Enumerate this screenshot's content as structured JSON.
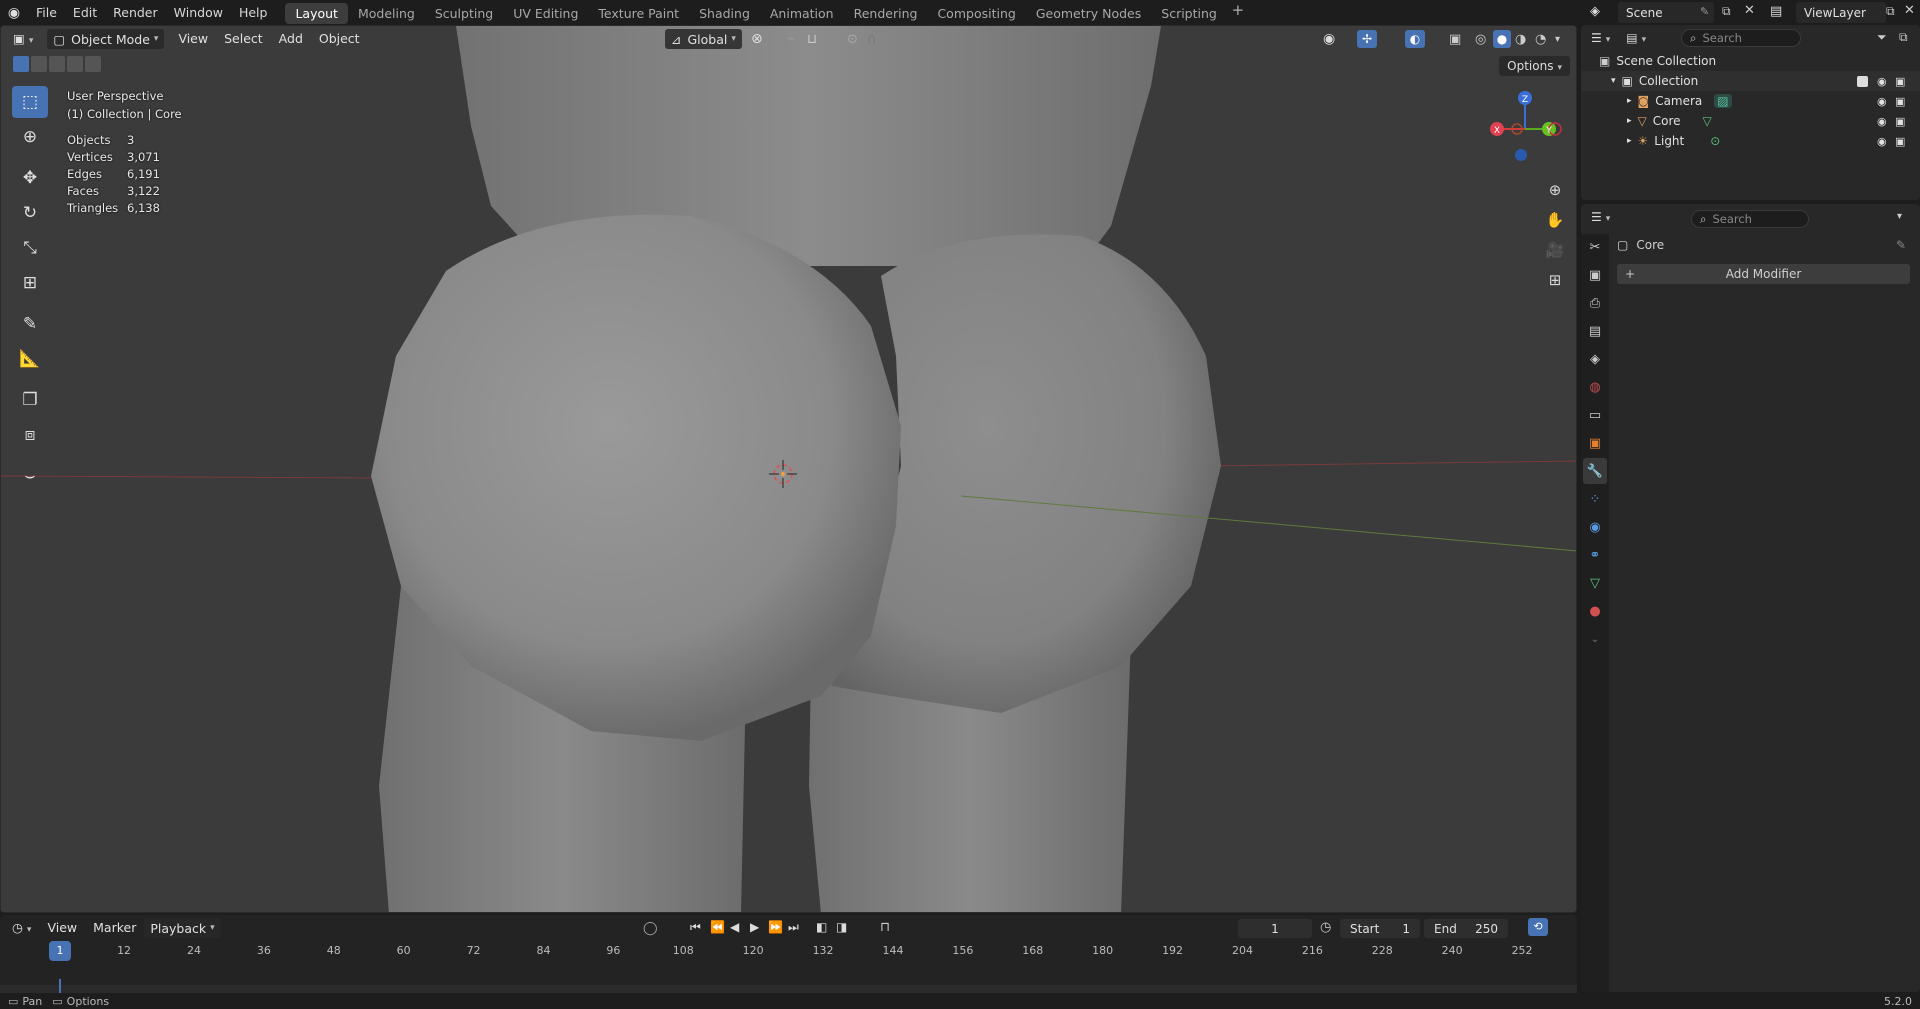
{
  "topbar": {
    "menus": [
      "File",
      "Edit",
      "Render",
      "Window",
      "Help"
    ],
    "workspaces": [
      "Layout",
      "Modeling",
      "Sculpting",
      "UV Editing",
      "Texture Paint",
      "Shading",
      "Animation",
      "Rendering",
      "Compositing",
      "Geometry Nodes",
      "Scripting"
    ],
    "active_workspace": "Layout",
    "scene": "Scene",
    "view_layer": "ViewLayer"
  },
  "viewport": {
    "mode": "Object Mode",
    "menus": [
      "View",
      "Select",
      "Add",
      "Object"
    ],
    "transform_orientation": "Global",
    "options_label": "Options",
    "overlay_title": "User Perspective",
    "overlay_subtitle": "(1) Collection | Core",
    "stats": [
      {
        "label": "Objects",
        "value": "3"
      },
      {
        "label": "Vertices",
        "value": "3,071"
      },
      {
        "label": "Edges",
        "value": "6,191"
      },
      {
        "label": "Faces",
        "value": "3,122"
      },
      {
        "label": "Triangles",
        "value": "6,138"
      }
    ],
    "gizmo": {
      "z": "Z",
      "y": "Y",
      "x": "X"
    }
  },
  "timeline": {
    "menus": [
      "View",
      "Marker"
    ],
    "playback": "Playback",
    "current_frame": "1",
    "start_label": "Start",
    "start_value": "1",
    "end_label": "End",
    "end_value": "250",
    "ticks": [
      "12",
      "24",
      "36",
      "48",
      "60",
      "72",
      "84",
      "96",
      "108",
      "120",
      "132",
      "144",
      "156",
      "168",
      "180",
      "192",
      "204",
      "216",
      "228",
      "240",
      "252"
    ],
    "playhead": "1"
  },
  "outliner": {
    "search_placeholder": "Search",
    "root": "Scene Collection",
    "collection": "Collection",
    "items": [
      "Camera",
      "Core",
      "Light"
    ]
  },
  "properties": {
    "search_placeholder": "Search",
    "object_name": "Core",
    "add_modifier": "Add Modifier"
  },
  "statusbar": {
    "pan": "Pan",
    "options": "Options",
    "version": "5.2.0"
  }
}
